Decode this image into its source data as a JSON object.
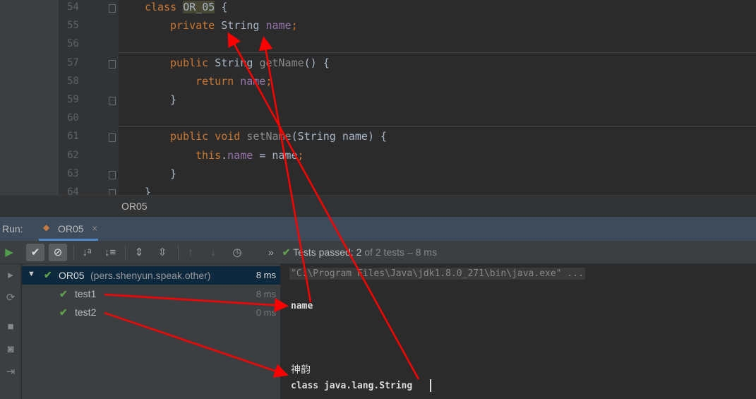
{
  "editor": {
    "lines": [
      {
        "n": "54",
        "parts": [
          [
            "kw",
            "class "
          ],
          [
            "hl",
            "OR_05"
          ],
          [
            "",
            "{"
          ]
        ]
      },
      {
        "n": "55",
        "parts": [
          [
            "kw",
            "private "
          ],
          [
            "",
            "String "
          ],
          [
            "fld",
            "name"
          ],
          [
            "kw",
            ";"
          ]
        ]
      },
      {
        "n": "56",
        "parts": []
      },
      {
        "n": "57",
        "parts": [
          [
            "kw",
            "public "
          ],
          [
            "",
            "String "
          ],
          [
            "mth",
            "getName"
          ],
          [
            "",
            "() {"
          ]
        ]
      },
      {
        "n": "58",
        "parts": [
          [
            "kw",
            "return "
          ],
          [
            "fld",
            "name"
          ],
          [
            "kw",
            ";"
          ]
        ]
      },
      {
        "n": "59",
        "parts": [
          [
            "",
            "}"
          ]
        ]
      },
      {
        "n": "60",
        "parts": []
      },
      {
        "n": "61",
        "parts": [
          [
            "kw",
            "public void "
          ],
          [
            "mth",
            "setName"
          ],
          [
            "",
            "(String name) {"
          ]
        ]
      },
      {
        "n": "62",
        "parts": [
          [
            "kw",
            "this"
          ],
          [
            "",
            "."
          ],
          [
            "fld",
            "name"
          ],
          [
            "",
            " = name"
          ],
          [
            "kw",
            ";"
          ]
        ]
      },
      {
        "n": "63",
        "parts": [
          [
            "",
            "}"
          ]
        ]
      },
      {
        "n": "64",
        "parts": [
          [
            "",
            "}"
          ]
        ]
      }
    ],
    "breadcrumb": "OR05"
  },
  "run": {
    "label": "Run:",
    "tab": "OR05",
    "close": "×"
  },
  "toolbar": {
    "status_prefix": "Tests passed:",
    "status_count": "2",
    "status_rest": "of 2 tests – 8 ms",
    "more": "»"
  },
  "tree": [
    {
      "name": "OR05",
      "pkg": "(pers.shenyun.speak.other)",
      "time": "8 ms"
    },
    {
      "name": "test1",
      "time": "8 ms"
    },
    {
      "name": "test2",
      "time": "0 ms"
    }
  ],
  "console": {
    "cmd": "\"C:\\Program Files\\Java\\jdk1.8.0_271\\bin\\java.exe\" ...",
    "out1": "name",
    "out2": "神韵",
    "out3": "class java.lang.String"
  },
  "colors": {
    "annotation": "#ff0000",
    "pass": "#5fa14a",
    "keyword": "#cc7832",
    "field": "#9876aa"
  }
}
